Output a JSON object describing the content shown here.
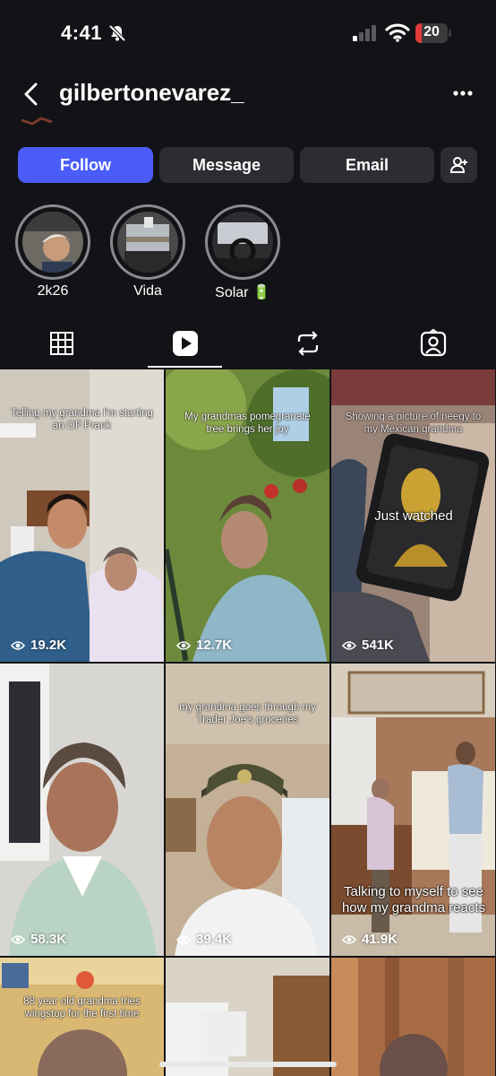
{
  "status_bar": {
    "time": "4:41",
    "battery": "20",
    "battery_level": 0.2
  },
  "header": {
    "username": "gilbertonevarez_"
  },
  "actions": {
    "follow": "Follow",
    "message": "Message",
    "email": "Email"
  },
  "highlights": [
    {
      "label": "2k26"
    },
    {
      "label": "Vida"
    },
    {
      "label": "Solar 🔋"
    }
  ],
  "tabs": [
    "grid-icon",
    "reels-icon",
    "reposts-icon",
    "tagged-icon"
  ],
  "posts": [
    {
      "caption": "Telling my grandma I'm starting an OF Prank",
      "views": "19.2K"
    },
    {
      "caption": "My grandmas pomegranate tree brings her joy",
      "views": "12.7K"
    },
    {
      "caption": "Showing a picture of neegy to my Mexican grandma",
      "overlay": "Just watched",
      "views": "541K"
    },
    {
      "caption": "",
      "views": "58.3K"
    },
    {
      "caption": "my grandma goes through my Trader Joe's groceries",
      "views": "39.4K"
    },
    {
      "caption": "",
      "overlay": "Talking to myself to see how my grandma reacts",
      "views": "41.9K"
    },
    {
      "caption": "88 year old grandma tries wingstop for the first time",
      "views": ""
    },
    {
      "caption": "",
      "views": ""
    },
    {
      "caption": "",
      "views": ""
    }
  ]
}
